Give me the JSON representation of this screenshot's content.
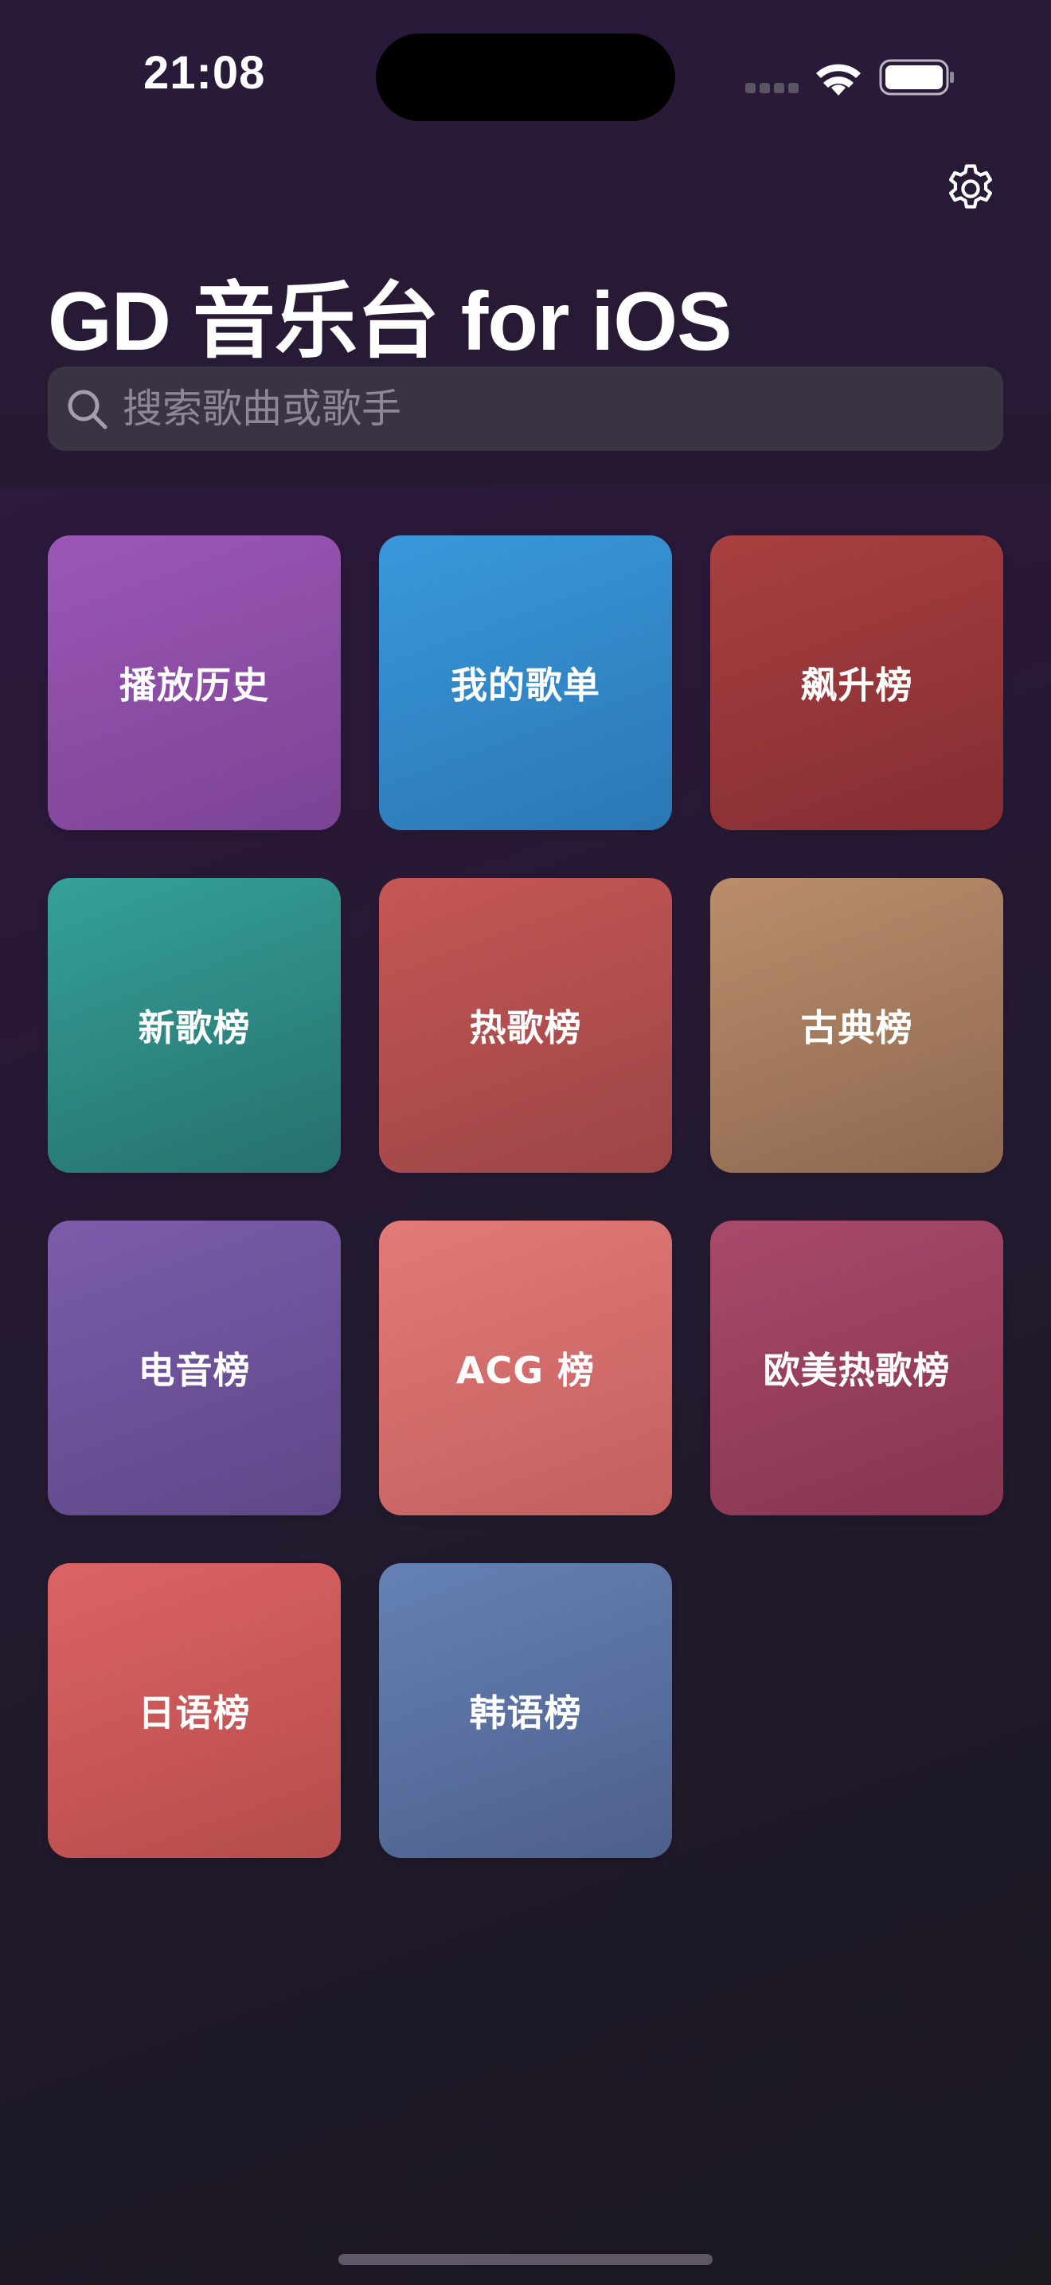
{
  "status_bar": {
    "time": "21:08",
    "icons": [
      "cellular-signal-icon",
      "wifi-icon",
      "battery-icon"
    ]
  },
  "header": {
    "title": "GD 音乐台 for iOS",
    "settings_icon": "gear-icon"
  },
  "search": {
    "placeholder": "搜索歌曲或歌手",
    "value": "",
    "icon": "search-icon"
  },
  "tiles": [
    {
      "label": "播放历史",
      "from": "#9c57b6",
      "to": "#7b4394"
    },
    {
      "label": "我的歌单",
      "from": "#3a98da",
      "to": "#2a77b3"
    },
    {
      "label": "飙升榜",
      "from": "#a8403f",
      "to": "#842d33"
    },
    {
      "label": "新歌榜",
      "from": "#35a09a",
      "to": "#26706c"
    },
    {
      "label": "热歌榜",
      "from": "#c65656",
      "to": "#9b4546"
    },
    {
      "label": "古典榜",
      "from": "#ba8e6c",
      "to": "#8d674f"
    },
    {
      "label": "电音榜",
      "from": "#7b5cab",
      "to": "#5e4788"
    },
    {
      "label": "ACG 榜",
      "from": "#e27a79",
      "to": "#c2605f"
    },
    {
      "label": "欧美热歌榜",
      "from": "#a84a6b",
      "to": "#86344f"
    },
    {
      "label": "日语榜",
      "from": "#dd6363",
      "to": "#b54c4c"
    },
    {
      "label": "韩语榜",
      "from": "#6581b4",
      "to": "#4d5f8c"
    }
  ]
}
